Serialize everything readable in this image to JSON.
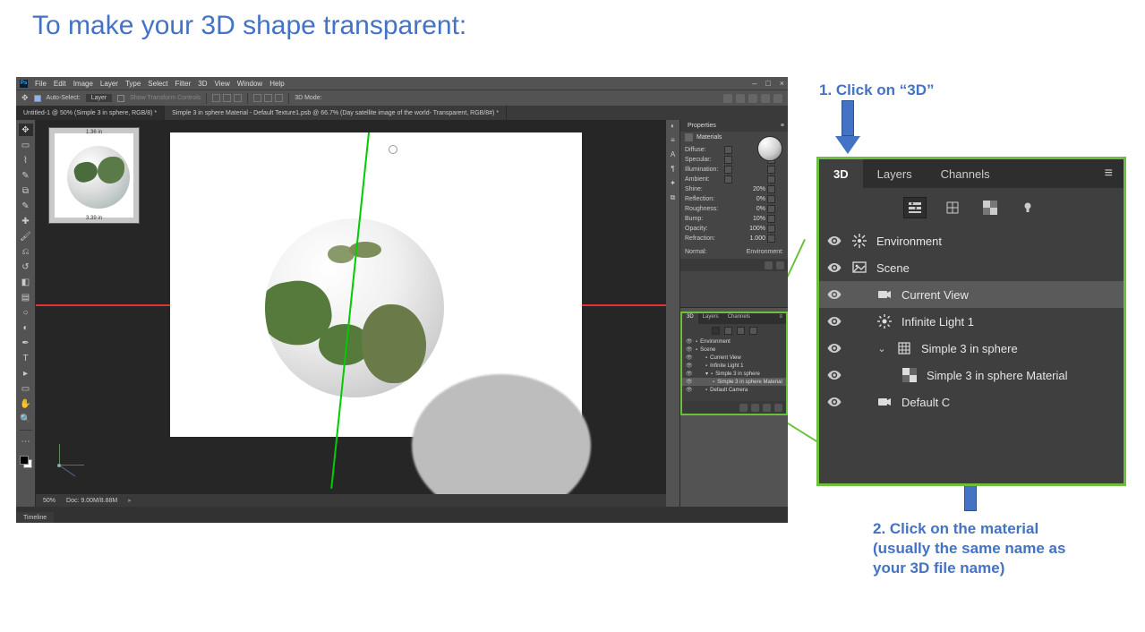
{
  "title": "To make your 3D shape transparent:",
  "callouts": {
    "step1": "1. Click on “3D”",
    "step2": "2. Click on the material (usually the same name as your 3D file name)"
  },
  "photoshop": {
    "menubar": [
      "File",
      "Edit",
      "Image",
      "Layer",
      "Type",
      "Select",
      "Filter",
      "3D",
      "View",
      "Window",
      "Help"
    ],
    "win_btns": {
      "min": "–",
      "max": "□",
      "close": "×"
    },
    "optionbar": {
      "auto_select_chk": true,
      "auto_select_label": "Auto-Select:",
      "auto_select_target": "Layer",
      "show_tc_chk": false,
      "show_tc_label": "Show Transform Controls",
      "mode_label": "3D Mode:"
    },
    "tabs": [
      "Untitled-1 @ 50% (Simple 3 in sphere, RGB/8) *",
      "Simple 3 in sphere Material - Default Texture1.psb @ 66.7% (Day satellite image of the world- Transparent, RGB/8#) *"
    ],
    "active_tab": 0,
    "navigator": {
      "top": "1.36 in",
      "bottom": "3.39 in"
    },
    "statusbar": {
      "zoom": "50%",
      "doc": "Doc: 9.00M/8.88M"
    },
    "timeline_tab": "Timeline",
    "properties": {
      "header": "Properties",
      "subhead": "Materials",
      "rows": [
        {
          "label": "Diffuse:"
        },
        {
          "label": "Specular:"
        },
        {
          "label": "Illumination:"
        },
        {
          "label": "Ambient:"
        },
        {
          "label": "Shine:",
          "value": "20%"
        },
        {
          "label": "Reflection:",
          "value": "0%"
        },
        {
          "label": "Roughness:",
          "value": "0%"
        },
        {
          "label": "Bump:",
          "value": "10%"
        },
        {
          "label": "Opacity:",
          "value": "100%"
        },
        {
          "label": "Refraction:",
          "value": "1.000"
        }
      ],
      "normal_label": "Normal:",
      "env_label": "Environment:"
    },
    "threeD_small": {
      "tabs": [
        "3D",
        "Layers",
        "Channels"
      ],
      "items": [
        {
          "label": "Environment"
        },
        {
          "label": "Scene"
        },
        {
          "label": "Current View",
          "indent": 1
        },
        {
          "label": "Infinite Light 1",
          "indent": 1
        },
        {
          "label": "Simple 3 in sphere",
          "indent": 1,
          "caret": true
        },
        {
          "label": "Simple 3 in sphere Material",
          "indent": 2,
          "selected": true
        },
        {
          "label": "Default Camera",
          "indent": 1
        }
      ]
    }
  },
  "zoom_panel": {
    "tabs": [
      "3D",
      "Layers",
      "Channels"
    ],
    "active_tab": 0,
    "items": [
      {
        "icon": "sparkle",
        "label": "Environment"
      },
      {
        "icon": "scene",
        "label": "Scene"
      },
      {
        "icon": "camera",
        "label": "Current View",
        "indent": 1,
        "selected": true
      },
      {
        "icon": "light",
        "label": "Infinite Light 1",
        "indent": 1
      },
      {
        "icon": "mesh",
        "label": "Simple 3 in sphere",
        "indent": 1,
        "caret": "down"
      },
      {
        "icon": "material",
        "label": "Simple 3 in sphere Material",
        "indent": 2
      },
      {
        "icon": "camera",
        "label": "Default C",
        "indent": 1,
        "truncated": true
      }
    ]
  }
}
